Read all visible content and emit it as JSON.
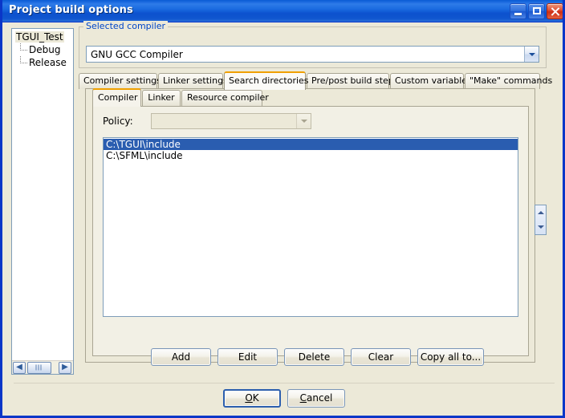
{
  "window": {
    "title": "Project build options",
    "controls": [
      {
        "name": "minimize",
        "glyph": "_"
      },
      {
        "name": "maximize",
        "glyph": "□"
      },
      {
        "name": "close",
        "glyph": "✕"
      }
    ]
  },
  "tree": {
    "root": "TGUI_Test",
    "children": [
      "Debug",
      "Release"
    ],
    "scroll_left": "◀",
    "scroll_right": "▶"
  },
  "compiler_group": {
    "title": "Selected compiler",
    "selected": "GNU GCC Compiler"
  },
  "tabs": [
    {
      "label": "Compiler settings",
      "active": false
    },
    {
      "label": "Linker settings",
      "active": false
    },
    {
      "label": "Search directories",
      "active": true
    },
    {
      "label": "Pre/post build steps",
      "active": false
    },
    {
      "label": "Custom variables",
      "active": false
    },
    {
      "label": "\"Make\" commands",
      "active": false
    }
  ],
  "subtabs": [
    {
      "label": "Compiler",
      "active": true
    },
    {
      "label": "Linker",
      "active": false
    },
    {
      "label": "Resource compiler",
      "active": false
    }
  ],
  "policy": {
    "label": "Policy:",
    "value": "",
    "enabled": false
  },
  "directories": [
    {
      "path": "C:\\TGUI\\include",
      "selected": true
    },
    {
      "path": "C:\\SFML\\include",
      "selected": false
    }
  ],
  "action_buttons": [
    {
      "label": "Add"
    },
    {
      "label": "Edit"
    },
    {
      "label": "Delete"
    },
    {
      "label": "Clear"
    },
    {
      "label": "Copy all to..."
    }
  ],
  "dialog_buttons": {
    "ok": {
      "pre": "",
      "accel": "O",
      "post": "K"
    },
    "cancel": {
      "pre": "",
      "accel": "C",
      "post": "ancel"
    }
  },
  "colors": {
    "dialog_bg": "#ECE9D8",
    "title_blue": "#0A5BD3",
    "accent_orange": "#F0A000",
    "selection_blue": "#2A5DB0",
    "group_label_blue": "#0046C8"
  }
}
